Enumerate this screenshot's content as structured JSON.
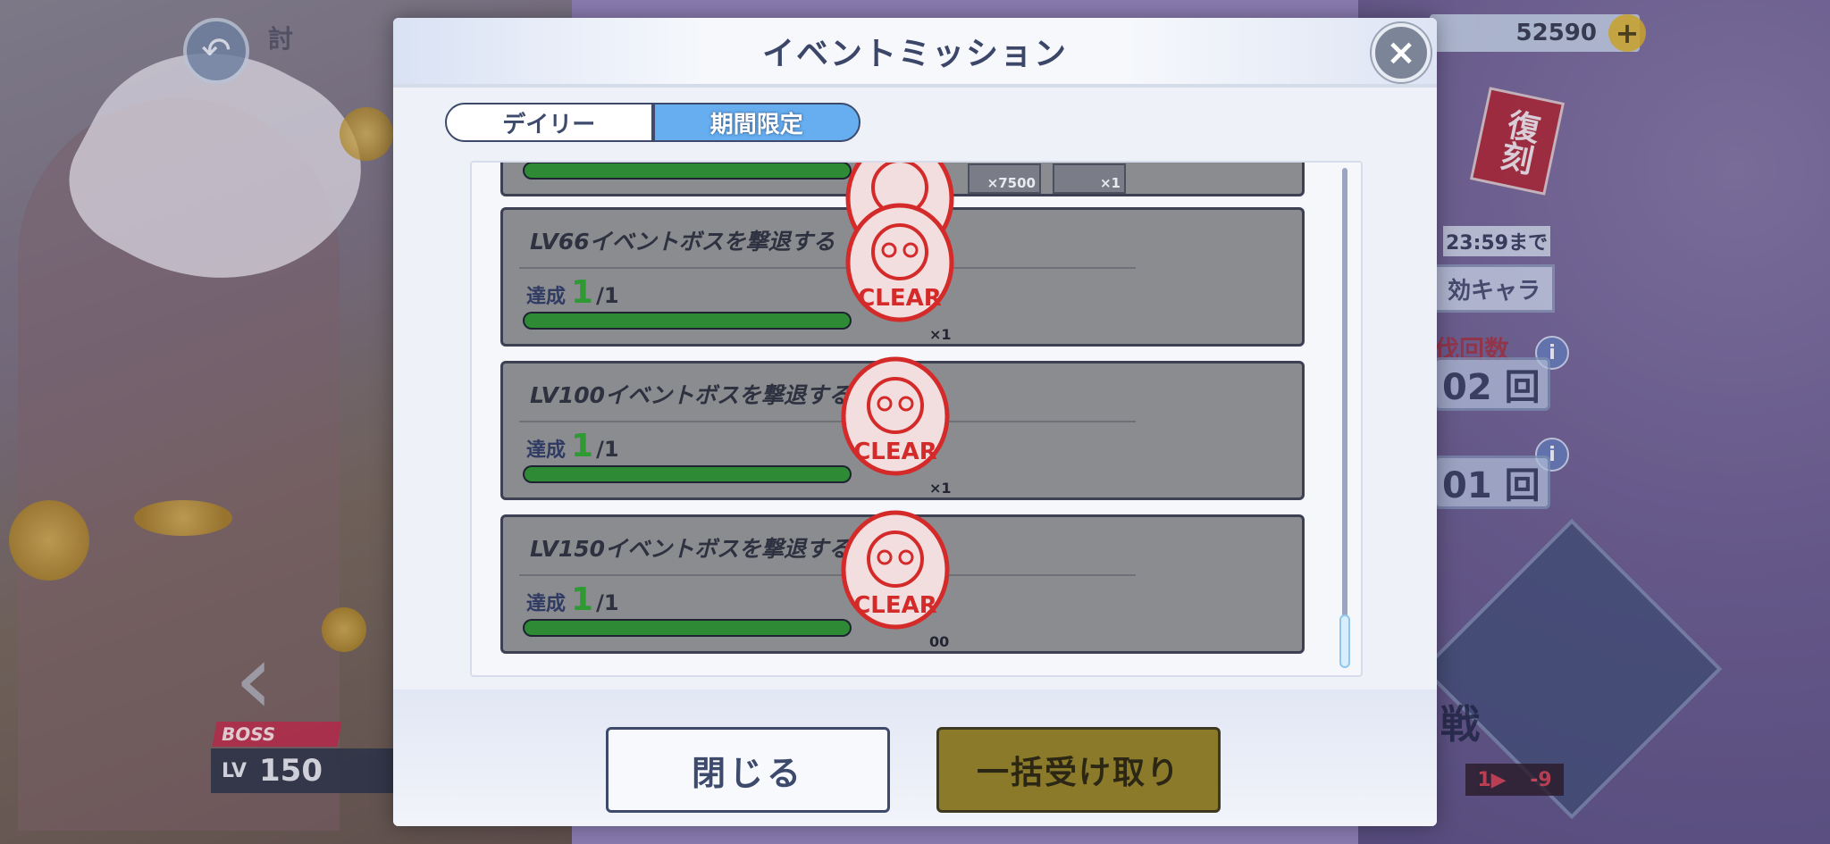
{
  "background": {
    "back_icon": "undo-arrow-icon",
    "title_fragment": "討",
    "currency_amount": "52590",
    "currency_add_icon": "plus-icon",
    "revival_badge": "復刻",
    "deadline": "23:59まで",
    "tokkou_button": "効キャラ",
    "tobatsu_label": "伐回数",
    "count_1": "02 回",
    "count_2": "01 回",
    "info_icon": "i",
    "challenge_label": "戦",
    "small_counter_left": "1▶",
    "small_counter_right": "-9",
    "boss_tag": "BOSS",
    "boss_level_prefix": "LV",
    "boss_level_value": "150",
    "prev_arrow": "‹"
  },
  "modal": {
    "title": "イベントミッション",
    "close_icon": "close-icon",
    "tabs": [
      {
        "label": "デイリー",
        "active": false
      },
      {
        "label": "期間限定",
        "active": true
      }
    ],
    "missions": [
      {
        "title": "",
        "progress_done": "",
        "progress_total": "",
        "progress_fraction": 1.0,
        "reward_qty": "×1",
        "extra_rewards": [
          "×7500",
          "×1"
        ],
        "cleared": true
      },
      {
        "title": "LV66イベントボスを撃退する",
        "progress_prefix": "達成",
        "progress_done": "1",
        "progress_total": "/1",
        "progress_fraction": 1.0,
        "reward_qty": "×1",
        "cleared": true
      },
      {
        "title": "LV100イベントボスを撃退する",
        "progress_prefix": "達成",
        "progress_done": "1",
        "progress_total": "/1",
        "progress_fraction": 1.0,
        "reward_qty": "×1",
        "cleared": true
      },
      {
        "title": "LV150イベントボスを撃退する",
        "progress_prefix": "達成",
        "progress_done": "1",
        "progress_total": "/1",
        "progress_fraction": 1.0,
        "reward_qty": "00",
        "cleared": true
      }
    ],
    "stamp_text": "CLEAR",
    "buttons": {
      "close": "閉じる",
      "receive_all": "一括受け取り"
    }
  },
  "colors": {
    "tab_active": "#66aef0",
    "progress_fill": "#2e8a34",
    "stamp_red": "#d42a2a",
    "receive_all_bg": "#8a7a2a"
  }
}
